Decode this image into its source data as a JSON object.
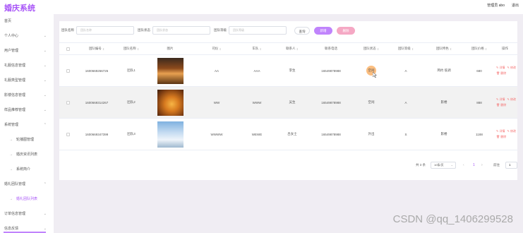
{
  "app": {
    "title": "婚庆系统"
  },
  "header": {
    "user_label": "管理员 abo",
    "logout_label": "退出"
  },
  "sidebar": {
    "items": [
      {
        "label": "首页",
        "has_arrow": false
      },
      {
        "label": "个人中心",
        "has_arrow": true
      },
      {
        "label": "用户管理",
        "has_arrow": true
      },
      {
        "label": "礼服信息管理",
        "has_arrow": true
      },
      {
        "label": "礼服类型管理",
        "has_arrow": true
      },
      {
        "label": "影楼信息管理",
        "has_arrow": true
      },
      {
        "label": "样品推荐管理",
        "has_arrow": true
      },
      {
        "label": "系统管理",
        "has_arrow": true
      },
      {
        "label": "轮播图管理",
        "sub": true
      },
      {
        "label": "婚庆资讯列表",
        "sub": true
      },
      {
        "label": "系统简介",
        "sub": true
      },
      {
        "label": "婚礼团队管理",
        "has_arrow": true
      },
      {
        "label": "婚礼团队列表",
        "sub": true,
        "active": true
      },
      {
        "label": "订单信息管理",
        "has_arrow": true
      },
      {
        "label": "信息反馈",
        "has_arrow": true
      }
    ]
  },
  "search": {
    "fields": [
      {
        "label": "团队名称",
        "placeholder": "团队名称"
      },
      {
        "label": "团队状态",
        "placeholder": "团队状态"
      },
      {
        "label": "团队等级",
        "placeholder": "团队等级"
      }
    ],
    "query_label": "查询",
    "add_label": "新增",
    "delete_label": "删除"
  },
  "table": {
    "columns": [
      "",
      "团队编号",
      "团队名称",
      "图片",
      "司仪",
      "车队",
      "联系人",
      "联系电话",
      "团队状态",
      "团队等级",
      "团队特色",
      "团队价格",
      "操作"
    ],
    "sortable": [
      false,
      true,
      true,
      false,
      true,
      true,
      true,
      false,
      true,
      true,
      true,
      true,
      false
    ],
    "rows": [
      {
        "id": "1600669266726",
        "name": "团队1",
        "mc": "AA",
        "cars": "AAA",
        "contact": "李生",
        "phone": "16549878988",
        "status": "空闲",
        "level": "A",
        "feature": "简约 低调",
        "price": "680"
      },
      {
        "id": "1600669314267",
        "name": "团队2",
        "mc": "WW",
        "cars": "WWW",
        "contact": "吴生",
        "phone": "16549878988",
        "status": "空闲",
        "level": "A",
        "feature": "影楼",
        "price": "888"
      },
      {
        "id": "1600669347399",
        "name": "团队3",
        "mc": "WWWW",
        "cars": "WEWE",
        "contact": "吕女士",
        "phone": "16549878988",
        "status": "外出",
        "level": "S",
        "feature": "影楼",
        "price": "1188"
      }
    ],
    "ops": {
      "detail": "详情",
      "edit": "修改",
      "delete": "删除"
    }
  },
  "pagination": {
    "total_label": "共 3 条",
    "page_size_label": "10条/页",
    "current_page": "1",
    "goto_label": "前往",
    "goto_value": "1"
  },
  "watermark": "CSDN @qq_1406299528"
}
